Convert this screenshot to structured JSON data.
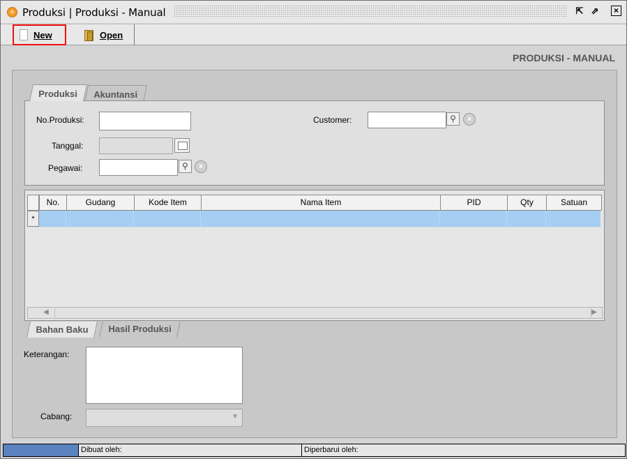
{
  "window": {
    "title": "Produksi | Produksi - Manual",
    "icon": "app-icon",
    "buttons": [
      "restore-icon",
      "maximize-icon",
      "close-icon"
    ]
  },
  "toolbar": {
    "new_label": "New",
    "open_label": "Open"
  },
  "page_title": "PRODUKSI - MANUAL",
  "top_tabs": [
    "Produksi",
    "Akuntansi"
  ],
  "form": {
    "no_produksi_label": "No.Produksi:",
    "no_produksi_value": "",
    "tanggal_label": "Tanggal:",
    "tanggal_value": "",
    "pegawai_label": "Pegawai:",
    "pegawai_value": "",
    "customer_label": "Customer:",
    "customer_value": ""
  },
  "grid": {
    "columns": [
      "No.",
      "Gudang",
      "Kode Item",
      "Nama Item",
      "PID",
      "Qty",
      "Satuan"
    ],
    "new_row_marker": "*"
  },
  "bottom_tabs": [
    "Bahan Baku",
    "Hasil Produksi"
  ],
  "footer": {
    "keterangan_label": "Keterangan:",
    "keterangan_value": "",
    "cabang_label": "Cabang:",
    "cabang_value": ""
  },
  "status": {
    "created_by_label": "Dibuat oleh:",
    "updated_by_label": "Diperbarui oleh:"
  }
}
